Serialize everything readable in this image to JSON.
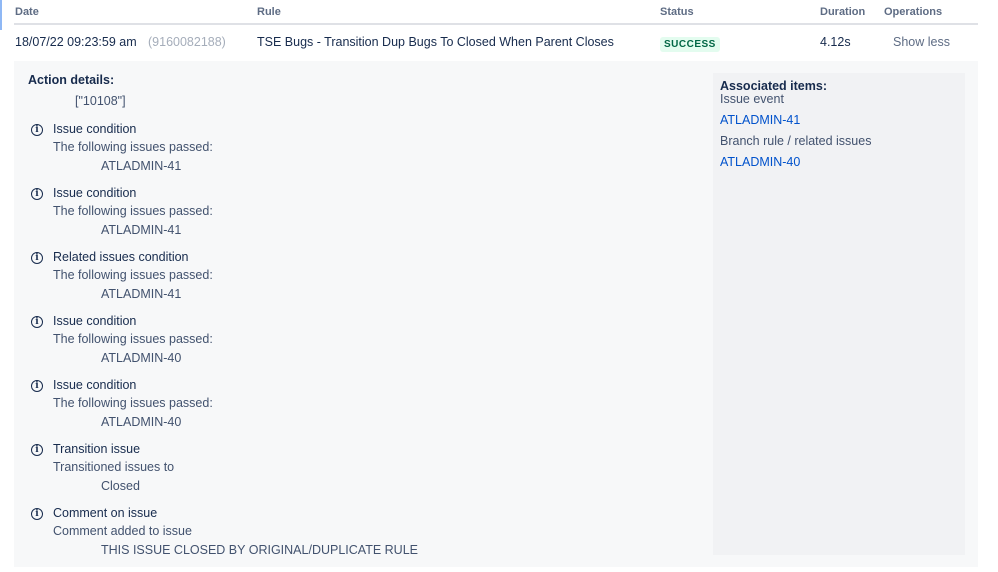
{
  "table": {
    "headers": {
      "date": "Date",
      "rule": "Rule",
      "status": "Status",
      "duration": "Duration",
      "operations": "Operations"
    },
    "row": {
      "date": "18/07/22 09:23:59 am",
      "id": "(9160082188)",
      "rule": "TSE Bugs - Transition Dup Bugs To Closed When Parent Closes",
      "status": "SUCCESS",
      "duration": "4.12s",
      "operation": "Show less"
    }
  },
  "details": {
    "title": "Action details:",
    "value": "[\"10108\"]",
    "items": [
      {
        "title": "Issue condition",
        "desc": "The following issues passed:",
        "value": "ATLADMIN-41"
      },
      {
        "title": "Issue condition",
        "desc": "The following issues passed:",
        "value": "ATLADMIN-41"
      },
      {
        "title": "Related issues condition",
        "desc": "The following issues passed:",
        "value": "ATLADMIN-41"
      },
      {
        "title": "Issue condition",
        "desc": "The following issues passed:",
        "value": "ATLADMIN-40"
      },
      {
        "title": "Issue condition",
        "desc": "The following issues passed:",
        "value": "ATLADMIN-40"
      },
      {
        "title": "Transition issue",
        "desc": "Transitioned issues to",
        "value": "Closed"
      },
      {
        "title": "Comment on issue",
        "desc": "Comment added to issue",
        "value": "THIS ISSUE CLOSED BY ORIGINAL/DUPLICATE RULE"
      }
    ]
  },
  "associated": {
    "title": "Associated items:",
    "event_label": "Issue event",
    "event_issue": "ATLADMIN-41",
    "branch_label": "Branch rule / related issues",
    "branch_issue": "ATLADMIN-40"
  }
}
